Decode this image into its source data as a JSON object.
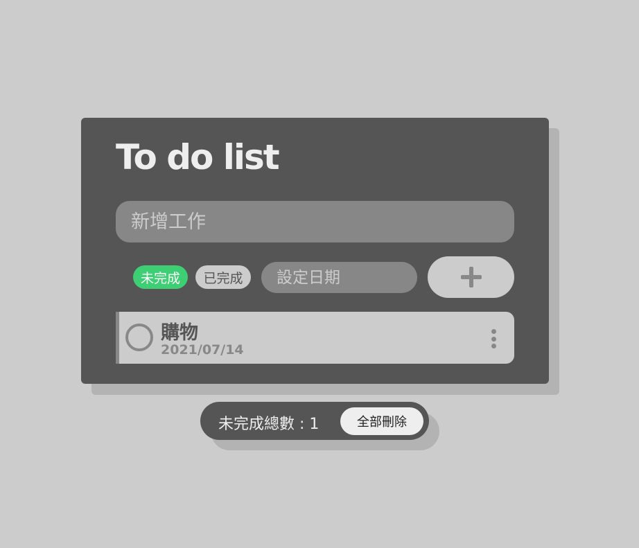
{
  "header": {
    "title": "To do list"
  },
  "new_task": {
    "placeholder": "新增工作"
  },
  "filters": [
    {
      "label": "未完成",
      "active": true,
      "color": "#3ecf74"
    },
    {
      "label": "已完成",
      "active": false
    }
  ],
  "date_input": {
    "placeholder": "設定日期"
  },
  "add_button": {
    "icon": "plus-icon"
  },
  "tasks": [
    {
      "title": "購物",
      "date": "2021/07/14",
      "done": false
    }
  ],
  "footer": {
    "count_label": "未完成總數 : 1",
    "clear_label": "全部刪除"
  }
}
